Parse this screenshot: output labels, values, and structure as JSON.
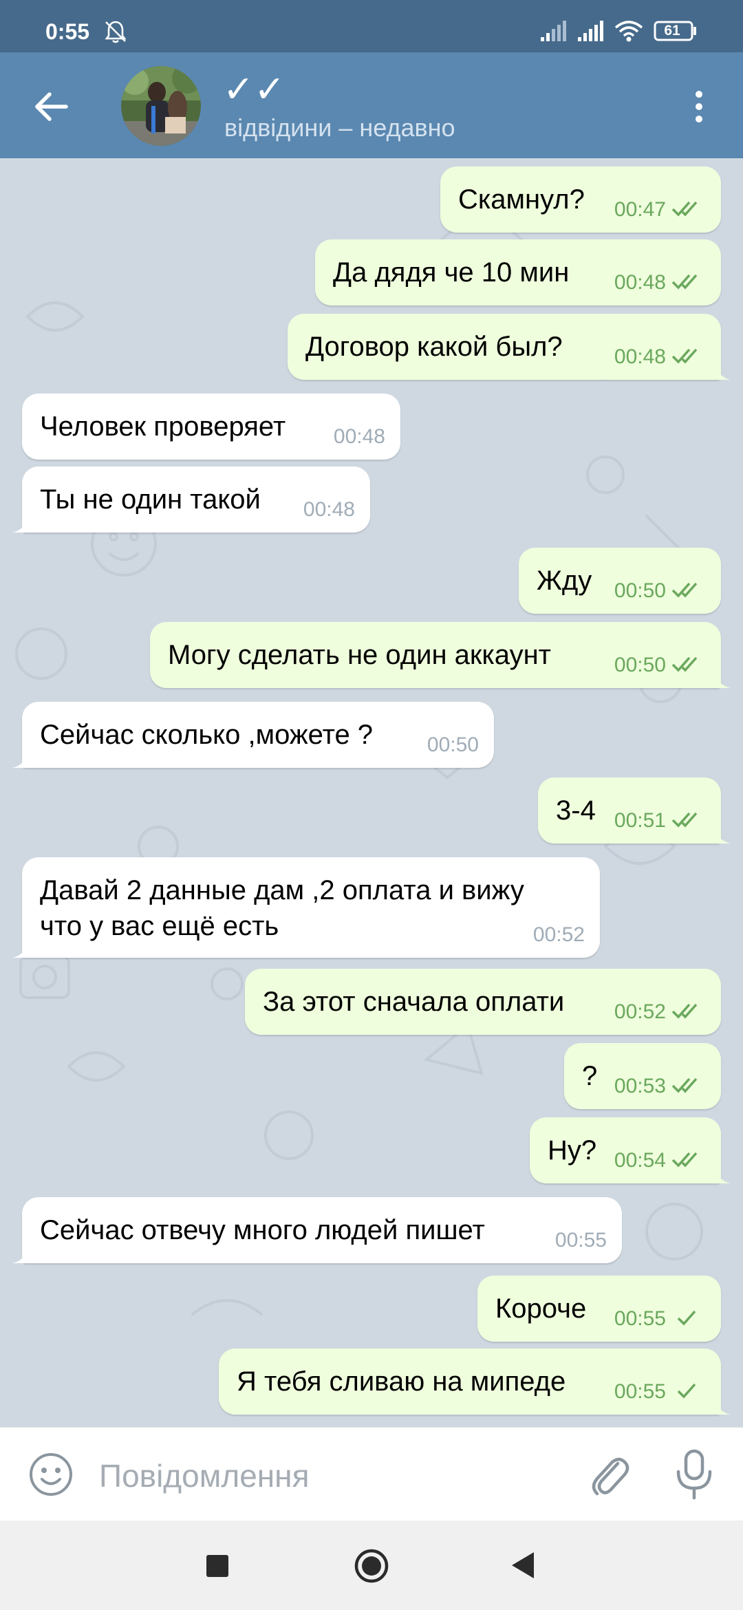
{
  "status_bar": {
    "time": "0:55",
    "battery": "61",
    "icons": [
      "bell-off-icon",
      "signal-icon",
      "signal-icon",
      "wifi-icon",
      "battery-icon"
    ]
  },
  "header": {
    "title": "✓✓",
    "status": "відвідини – недавно",
    "icons": [
      "back-arrow-icon",
      "avatar",
      "more-vert-icon"
    ]
  },
  "messages": [
    {
      "dir": "out",
      "text": "Скамнул?",
      "time": "00:47",
      "ticks": "double"
    },
    {
      "dir": "out",
      "text": "Да дядя че 10 мин",
      "time": "00:48",
      "ticks": "double"
    },
    {
      "dir": "out",
      "text": "Договор какой был?",
      "time": "00:48",
      "ticks": "double"
    },
    {
      "dir": "in",
      "text": "Человек проверяет",
      "time": "00:48"
    },
    {
      "dir": "in",
      "text": "Ты не один такой",
      "time": "00:48"
    },
    {
      "dir": "out",
      "text": "Жду",
      "time": "00:50",
      "ticks": "double"
    },
    {
      "dir": "out",
      "text": "Могу сделать не один аккаунт",
      "time": "00:50",
      "ticks": "double"
    },
    {
      "dir": "in",
      "text": "Сейчас сколько ,можете ?",
      "time": "00:50"
    },
    {
      "dir": "out",
      "text": "3-4",
      "time": "00:51",
      "ticks": "double"
    },
    {
      "dir": "in",
      "text": "Давай 2 данные дам ,2 оплата и вижу",
      "text2": "что у вас ещё есть",
      "time": "00:52"
    },
    {
      "dir": "out",
      "text": "За этот сначала оплати",
      "time": "00:52",
      "ticks": "double"
    },
    {
      "dir": "out",
      "text": "?",
      "time": "00:53",
      "ticks": "double"
    },
    {
      "dir": "out",
      "text": "Ну?",
      "time": "00:54",
      "ticks": "double"
    },
    {
      "dir": "in",
      "text": "Сейчас отвечу много людей пишет",
      "time": "00:55"
    },
    {
      "dir": "out",
      "text": "Короче",
      "time": "00:55",
      "ticks": "single"
    },
    {
      "dir": "out",
      "text": "Я тебя сливаю на мипеде",
      "time": "00:55",
      "ticks": "single"
    }
  ],
  "input_bar": {
    "placeholder": "Повідомлення",
    "icons": [
      "emoji-icon",
      "attach-icon",
      "mic-icon"
    ]
  },
  "nav_bar": {
    "icons": [
      "recents-icon",
      "home-icon",
      "back-icon"
    ]
  },
  "colors": {
    "status_bar": "#466a8b",
    "header": "#5b88b0",
    "chat_bg": "#cfd8e1",
    "outgoing_bubble": "#effedd",
    "incoming_bubble": "#ffffff",
    "outgoing_meta": "#6aa85d",
    "incoming_meta": "#a0acb6"
  }
}
